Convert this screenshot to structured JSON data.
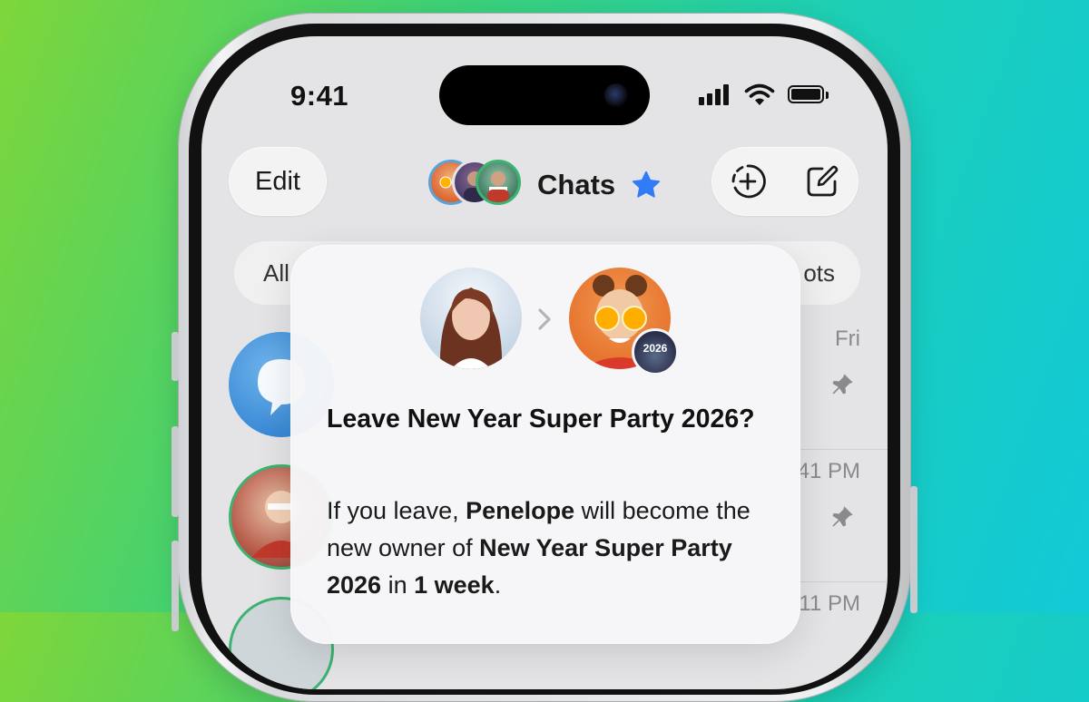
{
  "status_bar": {
    "time": "9:41",
    "icons": [
      "cellular-signal-icon",
      "wifi-icon",
      "battery-icon"
    ]
  },
  "nav": {
    "edit_label": "Edit",
    "title": "Chats",
    "title_icon": "star-icon",
    "right_icons": [
      "add-story-icon",
      "compose-icon"
    ]
  },
  "filters": {
    "first": "All",
    "last_partial": "ots"
  },
  "chat_list": [
    {
      "time": "Fri",
      "pinned": true
    },
    {
      "time": "41 PM",
      "pinned": true
    },
    {
      "time": "11 PM",
      "pinned": false
    }
  ],
  "dialog": {
    "title": "Leave New Year Super Party 2026?",
    "body": {
      "p1": "If you leave, ",
      "new_owner": "Penelope",
      "p2": " will become the new owner of ",
      "group": "New Year Super Party 2026",
      "p3": " in ",
      "period": "1 week",
      "p4": "."
    },
    "badge_text": "2026"
  },
  "colors": {
    "accent": "#2f7cf6",
    "background_left": "#7ed63a",
    "background_right": "#12c9d8"
  }
}
